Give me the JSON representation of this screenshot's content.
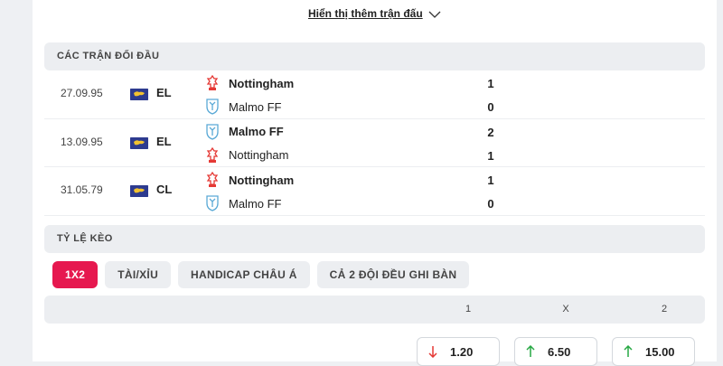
{
  "show_more": {
    "label": "Hiển thị thêm trận đấu"
  },
  "h2h": {
    "title": "CÁC TRẬN ĐỐI ĐẦU",
    "matches": [
      {
        "date": "27.09.95",
        "competition": "EL",
        "home": "Nottingham",
        "away": "Malmo FF",
        "home_score": "1",
        "away_score": "0"
      },
      {
        "date": "13.09.95",
        "competition": "EL",
        "home": "Malmo FF",
        "away": "Nottingham",
        "home_score": "2",
        "away_score": "1"
      },
      {
        "date": "31.05.79",
        "competition": "CL",
        "home": "Nottingham",
        "away": "Malmo FF",
        "home_score": "1",
        "away_score": "0"
      }
    ]
  },
  "odds": {
    "title": "TỶ LỆ KÈO",
    "tabs": [
      "1X2",
      "TÀI/XỈU",
      "HANDICAP CHÂU Á",
      "CẢ 2 ĐỘI ĐỀU GHI BÀN"
    ],
    "active_tab": "1X2",
    "columns": [
      "1",
      "X",
      "2"
    ],
    "values": [
      {
        "value": "1.20",
        "trend": "down",
        "trend_color": "#e53935"
      },
      {
        "value": "6.50",
        "trend": "up",
        "trend_color": "#27a844"
      },
      {
        "value": "15.00",
        "trend": "up",
        "trend_color": "#27a844"
      }
    ]
  },
  "colors": {
    "accent": "#e6184f",
    "header_bg": "#eceef1",
    "nottingham_red": "#e53935",
    "malmo_blue": "#5aa9d6"
  }
}
